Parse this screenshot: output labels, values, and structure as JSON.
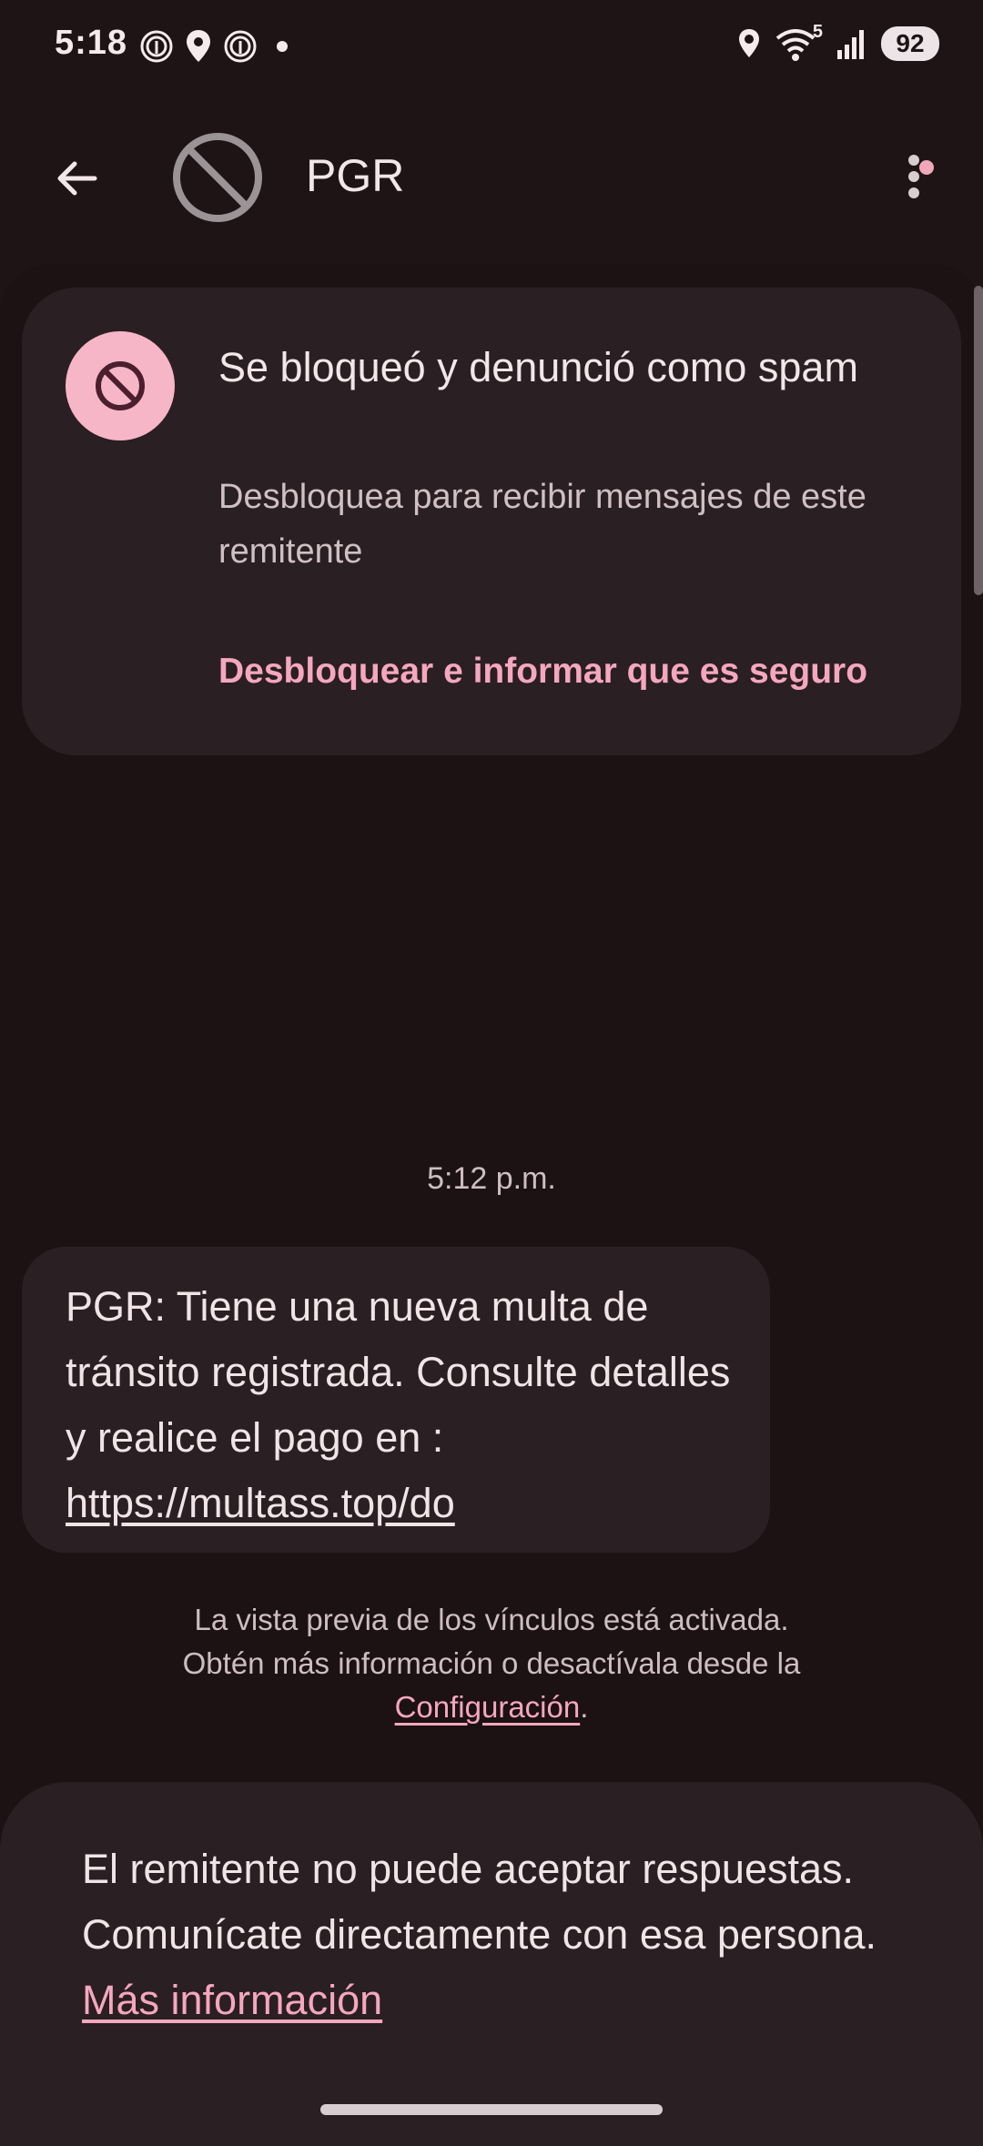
{
  "status_bar": {
    "time": "5:18",
    "battery": "92",
    "wifi_badge": "5",
    "left_icons": [
      "fingerprint-icon",
      "location-pin-icon",
      "fingerprint-icon",
      "dot-icon"
    ],
    "right_icons": [
      "location-icon",
      "wifi-icon",
      "signal-icon",
      "battery-badge"
    ]
  },
  "app_bar": {
    "title": "PGR",
    "back_icon": "arrow-back-icon",
    "avatar_icon": "block-icon",
    "more_icon": "more-vert-icon"
  },
  "spam_card": {
    "title": "Se bloqueó y denunció como spam",
    "subtitle": "Desbloquea para recibir mensajes de este remitente",
    "action": "Desbloquear e informar que es seguro",
    "icon": "block-icon"
  },
  "conversation": {
    "timestamp": "5:12 p.m.",
    "message": {
      "text": "PGR: Tiene una nueva multa de tránsito registrada. Consulte detalles y realice el pago en : ",
      "link": "https://multass.top/do"
    },
    "preview_notice": {
      "line1": "La vista previa de los vínculos está activada.",
      "line2": "Obtén más información o desactívala desde la",
      "link": "Configuración",
      "suffix": "."
    }
  },
  "reply_panel": {
    "text": "El remitente no puede aceptar respuestas. Comunícate directamente con esa persona. ",
    "link": "Más información"
  },
  "colors": {
    "background": "#1e1416",
    "surface": "#2a1f22",
    "accent": "#f5a7bf",
    "text": "#f1e4e7"
  }
}
